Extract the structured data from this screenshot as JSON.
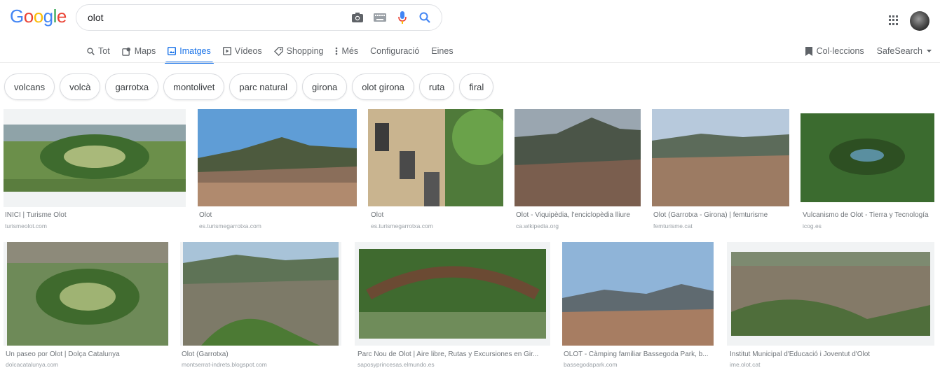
{
  "logo": "Google",
  "search": {
    "query": "olot"
  },
  "nav": {
    "tabs": [
      {
        "label": "Tot",
        "icon": "search-icon"
      },
      {
        "label": "Maps",
        "icon": "map-pin-icon"
      },
      {
        "label": "Imatges",
        "icon": "image-icon",
        "active": true
      },
      {
        "label": "Vídeos",
        "icon": "play-icon"
      },
      {
        "label": "Shopping",
        "icon": "tag-icon"
      },
      {
        "label": "Més",
        "icon": "more-vert-icon"
      },
      {
        "label": "Configuració"
      },
      {
        "label": "Eines"
      }
    ],
    "collections": "Col·leccions",
    "safesearch": "SafeSearch"
  },
  "chips": [
    "volcans",
    "volcà",
    "garrotxa",
    "montolivet",
    "parc natural",
    "girona",
    "olot girona",
    "ruta",
    "firal"
  ],
  "results": [
    {
      "title": "INICI | Turisme Olot",
      "source": "turismeolot.com"
    },
    {
      "title": "Olot",
      "source": "es.turismegarrotxa.com"
    },
    {
      "title": "Olot",
      "source": "es.turismegarrotxa.com"
    },
    {
      "title": "Olot - Viquipèdia, l'enciclopèdia lliure",
      "source": "ca.wikipedia.org"
    },
    {
      "title": "Olot (Garrotxa - Girona) | femturisme",
      "source": "femturisme.cat"
    },
    {
      "title": "Vulcanismo de Olot - Tierra y Tecnología",
      "source": "icog.es"
    },
    {
      "title": "Un paseo por Olot | Dolça Catalunya",
      "source": "dolcacatalunya.com"
    },
    {
      "title": "Olot (Garrotxa)",
      "source": "montserrat-indrets.blogspot.com"
    },
    {
      "title": "Parc Nou de Olot | Aire libre, Rutas y Excursiones en Gir...",
      "source": "saposyprincesas.elmundo.es"
    },
    {
      "title": "OLOT - Càmping familiar Bassegoda Park, b...",
      "source": "bassegodapark.com"
    },
    {
      "title": "Institut Municipal d'Educació i Joventut d'Olot",
      "source": "ime.olot.cat"
    }
  ],
  "colors": {
    "accent": "#1a73e8",
    "text_muted": "#70757a"
  }
}
